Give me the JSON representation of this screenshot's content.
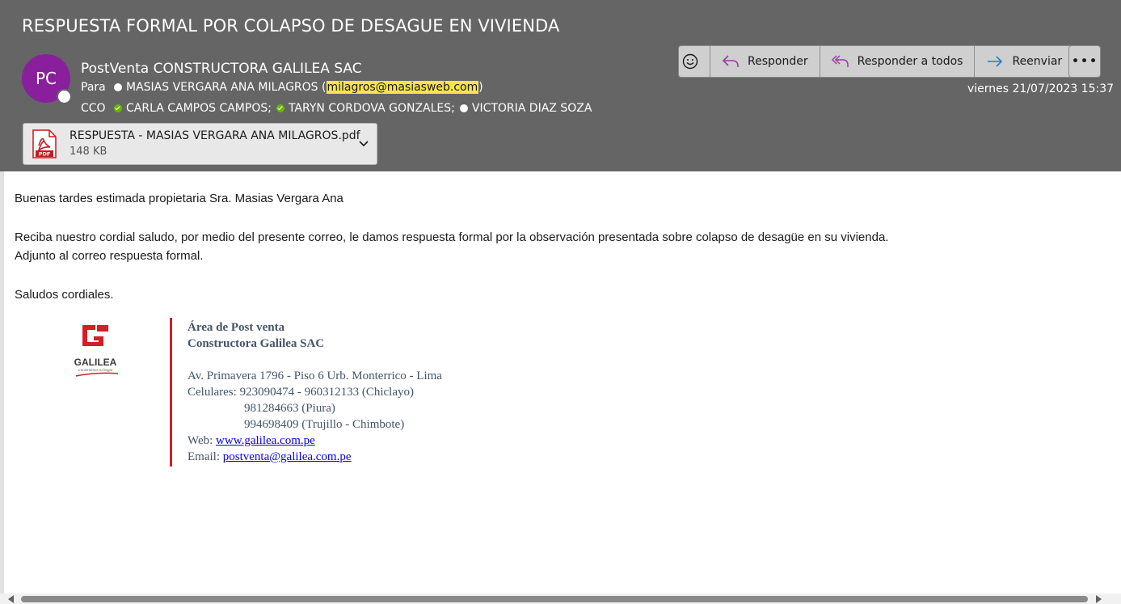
{
  "header": {
    "subject": "RESPUESTA FORMAL POR COLAPSO DE DESAGUE EN VIVIENDA",
    "avatar_initials": "PC",
    "sender": "PostVenta CONSTRUCTORA GALILEA SAC",
    "to_label": "Para",
    "to_name": "MASIAS VERGARA ANA MILAGROS",
    "to_email": "milagros@masiasweb.com",
    "cc_label": "CCO",
    "cc": [
      {
        "name": "CARLA CAMPOS CAMPOS;",
        "status": "available"
      },
      {
        "name": "TARYN CORDOVA GONZALES;",
        "status": "available"
      },
      {
        "name": "VICTORIA DIAZ SOZA",
        "status": "unknown"
      }
    ],
    "date": "viernes 21/07/2023 15:37"
  },
  "toolbar": {
    "emoji_icon": "smiley-icon",
    "reply_label": "Responder",
    "reply_all_label": "Responder a todos",
    "forward_label": "Reenviar",
    "more_label": "•••"
  },
  "attachment": {
    "icon": "pdf-icon",
    "name": "RESPUESTA - MASIAS VERGARA ANA MILAGROS.pdf",
    "size": "148 KB"
  },
  "body": {
    "greeting": "Buenas tardes estimada propietaria Sra. Masias Vergara Ana",
    "line1": "Reciba nuestro cordial saludo, por medio del presente correo, le damos respuesta formal por la observación presentada sobre colapso de desagüe en su vivienda.",
    "line2": "Adjunto al correo respuesta formal.",
    "closing": "Saludos cordiales."
  },
  "signature": {
    "logo_text": "GALILEA",
    "logo_tagline": "Construimos tu hogar",
    "area": "Área de Post venta",
    "company": "Constructora Galilea SAC",
    "address": "Av. Primavera 1796 - Piso 6 Urb. Monterrico - Lima",
    "phones_label": "Celulares:",
    "phone1": "923090474 - 960312133 (Chiclayo)",
    "phone2": "981284663 (Piura)",
    "phone3": "994698409 (Trujillo - Chimbote)",
    "web_label": "Web:",
    "web": "www.galilea.com.pe",
    "email_label": "Email:",
    "email": "postventa@galilea.com.pe"
  },
  "colors": {
    "header_bg": "#656565",
    "avatar_bg": "#8a1f9e",
    "highlight": "#f5e44e",
    "signature_bar": "#d41f26",
    "signature_text": "#44546a"
  }
}
